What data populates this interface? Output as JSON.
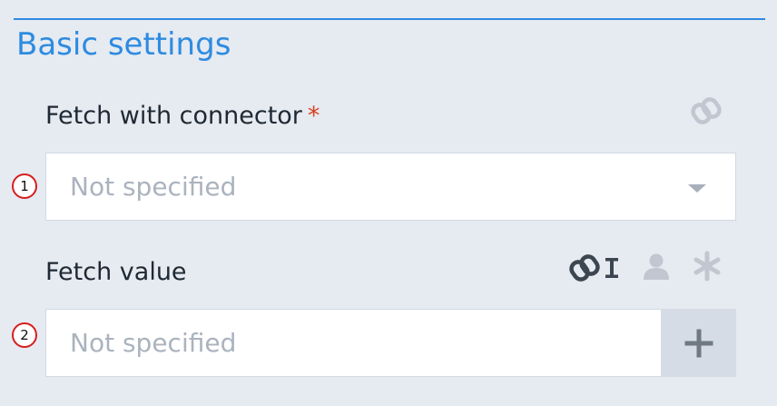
{
  "section": {
    "title": "Basic settings"
  },
  "fields": [
    {
      "marker": "1",
      "label": "Fetch with connector",
      "required_mark": "*",
      "value": "Not specified",
      "icons": [
        "link-icon"
      ],
      "control": "dropdown"
    },
    {
      "marker": "2",
      "label": "Fetch value",
      "value": "Not specified",
      "icons": [
        "link-icon",
        "text-cursor-icon",
        "user-icon",
        "asterisk-icon"
      ],
      "action": "plus-icon"
    }
  ],
  "colors": {
    "accent": "#2d8be0",
    "required": "#d9411e",
    "placeholder": "#aab3be",
    "background": "#e6eaf1",
    "marker_ring": "#d61f1f"
  }
}
